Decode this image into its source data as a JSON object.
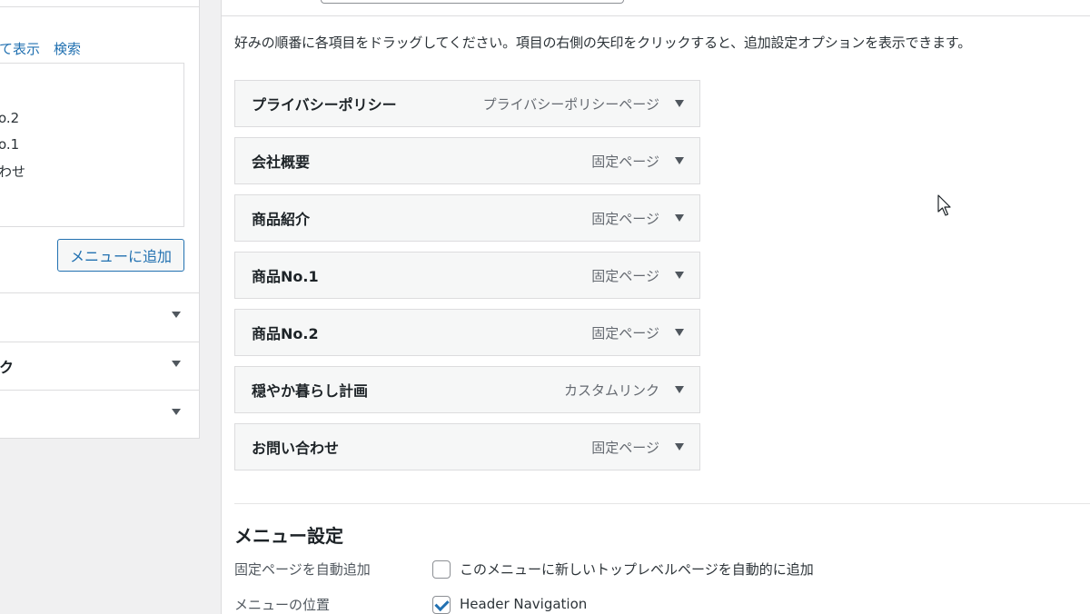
{
  "left_panel": {
    "tabs": [
      "て表示",
      "検索"
    ],
    "list_items": [
      "o.2",
      "o.1",
      "わせ"
    ],
    "add_button": "メニューに追加",
    "accordions": [
      "",
      "ク",
      ""
    ]
  },
  "main": {
    "instruction": "好みの順番に各項目をドラッグしてください。項目の右側の矢印をクリックすると、追加設定オプションを表示できます。",
    "menu_items": [
      {
        "title": "プライバシーポリシー",
        "type": "プライバシーポリシーページ"
      },
      {
        "title": "会社概要",
        "type": "固定ページ"
      },
      {
        "title": "商品紹介",
        "type": "固定ページ"
      },
      {
        "title": "商品No.1",
        "type": "固定ページ"
      },
      {
        "title": "商品No.2",
        "type": "固定ページ"
      },
      {
        "title": "穏やか暮らし計画",
        "type": "カスタムリンク"
      },
      {
        "title": "お問い合わせ",
        "type": "固定ページ"
      }
    ]
  },
  "settings": {
    "title": "メニュー設定",
    "auto_add_label": "固定ページを自動追加",
    "auto_add_text": "このメニューに新しいトップレベルページを自動的に追加",
    "auto_add_checked": false,
    "location_label": "メニューの位置",
    "location_text": "Header Navigation",
    "location_checked": true
  },
  "colors": {
    "link": "#2271b1",
    "panel_bg": "#ffffff",
    "page_bg": "#f0f0f1",
    "item_bg": "#f6f7f7"
  }
}
